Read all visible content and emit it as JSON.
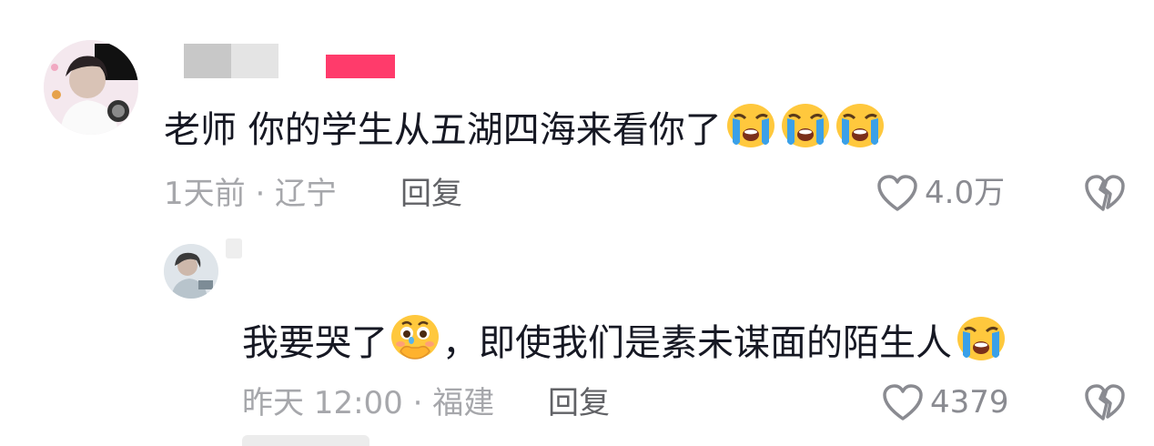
{
  "comments": [
    {
      "text": "老师 你的学生从五湖四海来看你了",
      "emojis": [
        "loudly-crying-face",
        "loudly-crying-face",
        "loudly-crying-face"
      ],
      "time_location": "1天前 · 辽宁",
      "reply_label": "回复",
      "likes": "4.0万"
    },
    {
      "text_before": "我要哭了",
      "text_after": "，即使我们是素未谋面的陌生人",
      "emojis": [
        "face-holding-back-tears",
        "loudly-crying-face"
      ],
      "time_location": "昨天 12:00 · 福建",
      "reply_label": "回复",
      "likes": "4379"
    }
  ],
  "icons": {
    "like": "heart-outline-icon",
    "dislike": "broken-heart-icon"
  },
  "colors": {
    "text": "#161823",
    "meta": "#a6a7ab",
    "reply": "#616266",
    "redacted_gray": "#c8c8c8",
    "redacted_pink": "#ff3b6b"
  }
}
